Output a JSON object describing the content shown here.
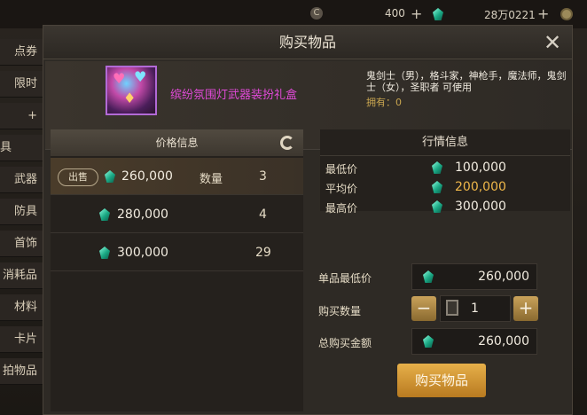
{
  "topbar": {
    "coin_symbol": "C",
    "currency1_value": "400",
    "currency2_value": "28万0221",
    "plus": "+"
  },
  "sidebar": {
    "items": [
      {
        "label": "点券"
      },
      {
        "label": "限时"
      },
      {
        "label": "+"
      },
      {
        "label": "具"
      },
      {
        "label": "武器"
      },
      {
        "label": "防具"
      },
      {
        "label": "首饰"
      },
      {
        "label": "消耗品"
      },
      {
        "label": "材料"
      },
      {
        "label": "卡片"
      },
      {
        "label": "拍物品"
      }
    ]
  },
  "modal": {
    "title": "购买物品",
    "close": "✕",
    "item": {
      "name": "缤纷氛围灯武器装扮礼盒",
      "description": "鬼剑士（男），格斗家，神枪手，魔法师，鬼剑士（女），圣职者 可使用",
      "owned": "拥有：0"
    },
    "price_panel": {
      "header": "价格信息",
      "sell_label": "出售",
      "qty_label": "数量",
      "rows": [
        {
          "price": "260,000",
          "qty": "3"
        },
        {
          "price": "280,000",
          "qty": "4"
        },
        {
          "price": "300,000",
          "qty": "29"
        }
      ]
    },
    "market": {
      "header": "行情信息",
      "min_label": "最低价",
      "min_value": "100,000",
      "avg_label": "平均价",
      "avg_value": "200,000",
      "max_label": "最高价",
      "max_value": "300,000"
    },
    "purchase": {
      "unit_min_label": "单品最低价",
      "unit_min_value": "260,000",
      "qty_label": "购买数量",
      "qty_value": "1",
      "minus": "−",
      "plus": "+",
      "total_label": "总购买金额",
      "total_value": "260,000",
      "buy_button": "购买物品"
    }
  },
  "colors": {
    "item_name": "#e04ad8",
    "avg_price": "#f0b84a",
    "owned": "#c9a650",
    "buy_button": "#d9a040"
  }
}
